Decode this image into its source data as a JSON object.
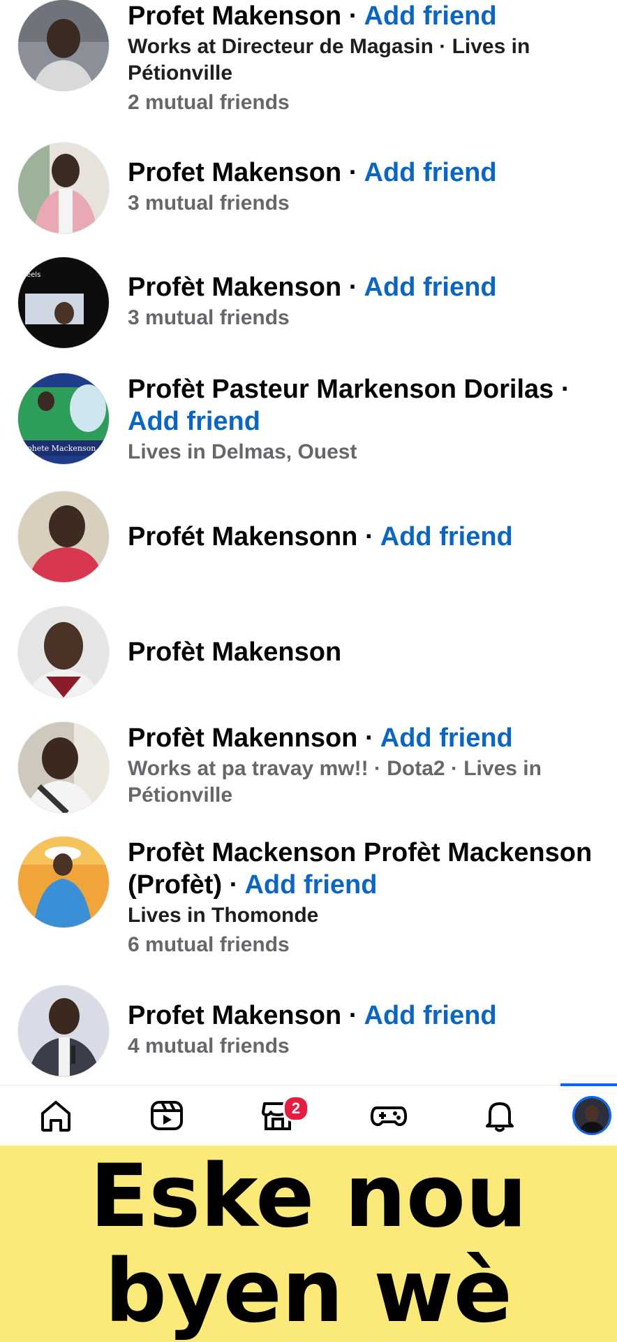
{
  "results": [
    {
      "name": "Profet Makenson",
      "separator": "·",
      "action": "Add friend",
      "lines": [
        {
          "text": "Works at Directeur de Magasin · Lives in Pétionville",
          "style": "dark"
        },
        {
          "text": "2 mutual friends",
          "style": "muted"
        }
      ]
    },
    {
      "name": "Profet Makenson",
      "separator": "·",
      "action": "Add friend",
      "lines": [
        {
          "text": "3 mutual friends",
          "style": "muted"
        }
      ]
    },
    {
      "name": "Profèt Makenson",
      "separator": "·",
      "action": "Add friend",
      "lines": [
        {
          "text": "3 mutual friends",
          "style": "muted"
        }
      ]
    },
    {
      "name": "Profèt Pasteur Markenson Dorilas",
      "separator": "·",
      "action": "Add friend",
      "lines": [
        {
          "text": "Lives in Delmas, Ouest",
          "style": "muted"
        }
      ]
    },
    {
      "name": "Profét Makensonn",
      "separator": "·",
      "action": "Add friend",
      "lines": []
    },
    {
      "name": "Profèt Makenson",
      "separator": "",
      "action": "",
      "lines": []
    },
    {
      "name": "Profèt Makennson",
      "separator": "·",
      "action": "Add friend",
      "lines": [
        {
          "text": "Works at pa travay mw!! · Dota2 · Lives in Pétionville",
          "style": "muted"
        }
      ]
    },
    {
      "name": "Profèt Mackenson Profèt Mackenson (Profèt)",
      "separator": "·",
      "action": "Add friend",
      "lines": [
        {
          "text": "Lives in Thomonde",
          "style": "dark"
        },
        {
          "text": "6 mutual friends",
          "style": "muted"
        }
      ]
    },
    {
      "name": "Profet Makenson",
      "separator": "·",
      "action": "Add friend",
      "lines": [
        {
          "text": "4 mutual friends",
          "style": "muted"
        }
      ]
    }
  ],
  "avatar_labels": {
    "reels": "eels",
    "banner": "ophete Mackenson"
  },
  "navbar": {
    "items": [
      "home-icon",
      "reels-icon",
      "marketplace-icon",
      "gaming-icon",
      "bell-icon",
      "profile-avatar"
    ],
    "badge": "2",
    "active": "profile-avatar"
  },
  "caption": {
    "text": "Eske nou byen wè"
  },
  "colors": {
    "link": "#0a66c2",
    "badge": "#e41e3f",
    "caption_bg": "#fbe979",
    "active": "#0866ff"
  }
}
